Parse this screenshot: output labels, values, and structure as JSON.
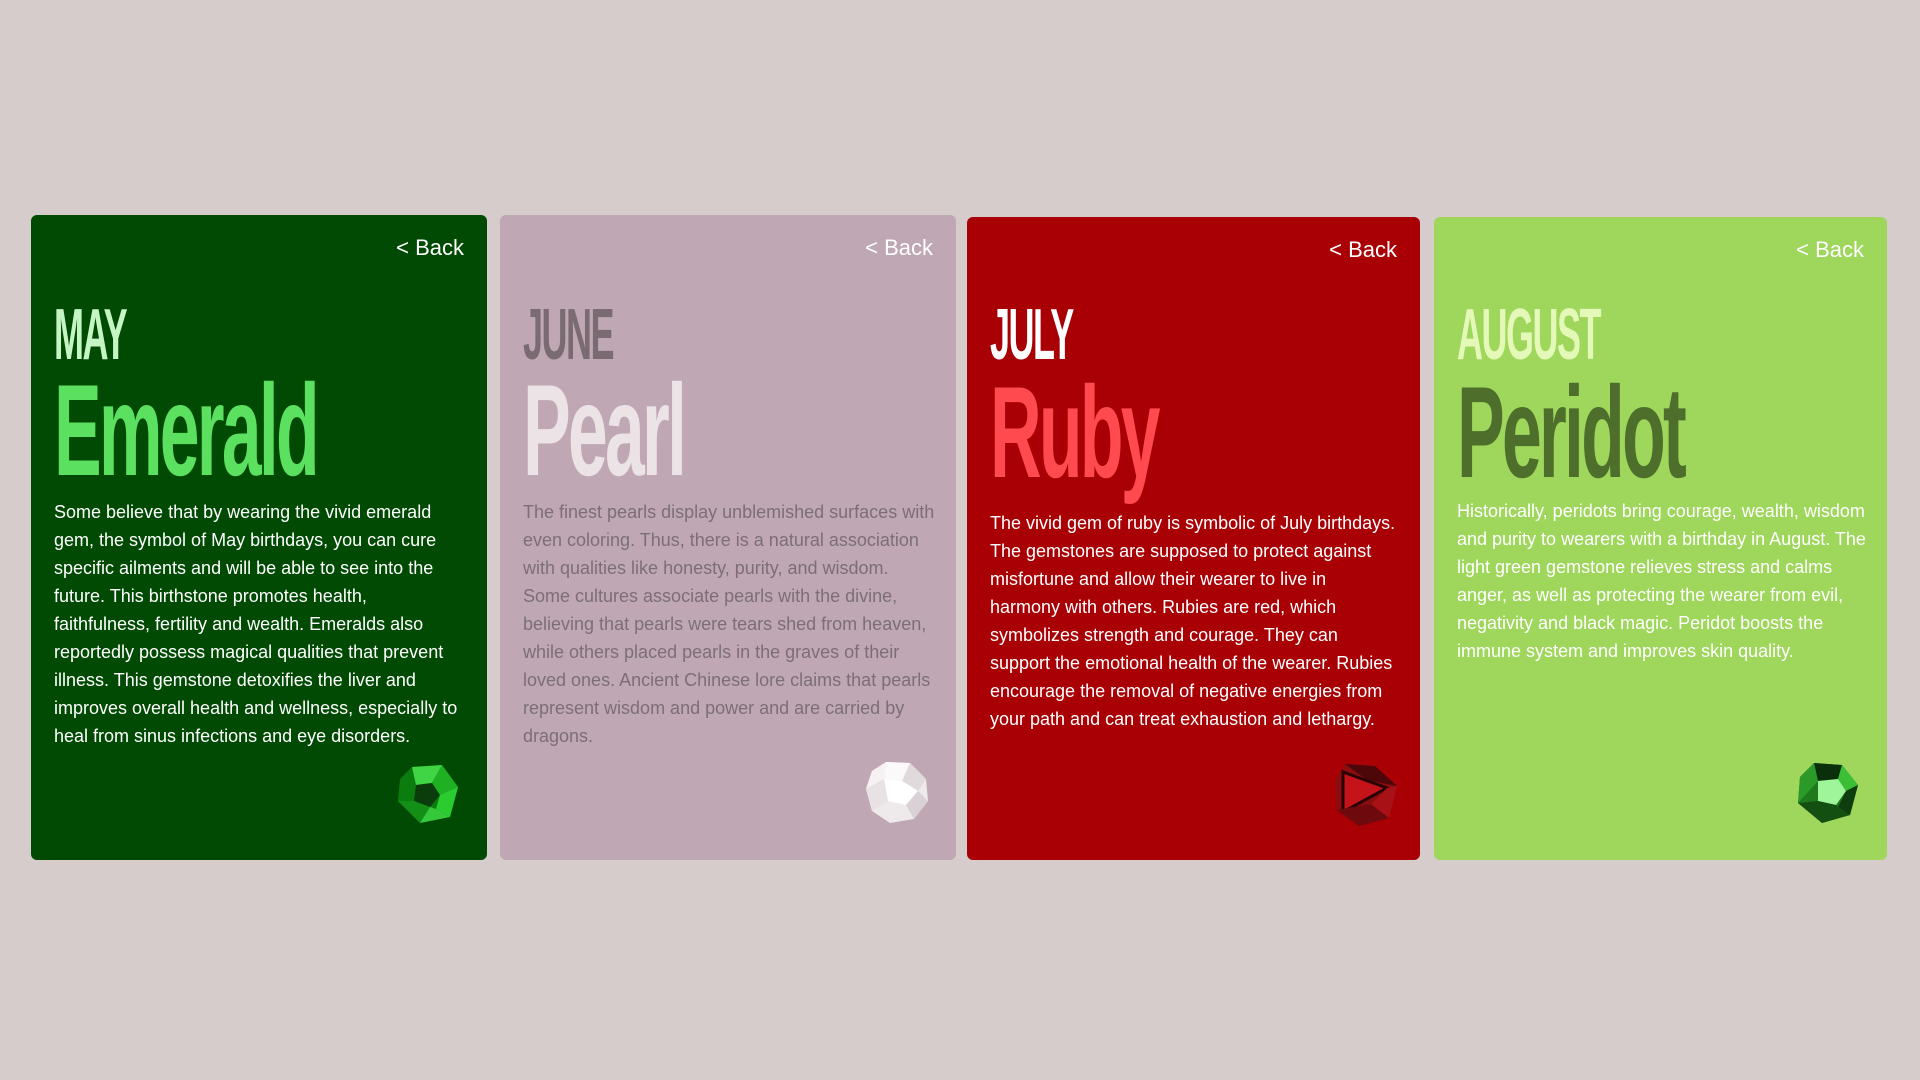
{
  "cards": [
    {
      "back_label": "< Back",
      "month": "MAY",
      "gem": "Emerald",
      "description": "Some believe that by wearing the vivid emerald gem, the symbol of May birthdays, you can cure specific ailments and will be able to see into the future. This birthstone promotes health, faithfulness, fertility and wealth. Emeralds also reportedly possess magical qualities that prevent illness. This gemstone detoxifies the liver and improves overall health and wellness, especially to heal from sinus infections and eye disorders.",
      "gem_icon": "emerald-gem-icon",
      "colors": {
        "background": "#014a03",
        "month": "#c6f5c4",
        "gem": "#5ce05f",
        "text": "#ffffff",
        "back": "#ffffff"
      }
    },
    {
      "back_label": "< Back",
      "month": "JUNE",
      "gem": "Pearl",
      "description": "The finest pearls display unblemished surfaces with even coloring. Thus, there is a natural association with qualities like honesty, purity, and wisdom. Some cultures associate pearls with the divine, believing that pearls were tears shed from heaven, while others placed pearls in the graves of their loved ones. Ancient Chinese lore claims that pearls represent wisdom and power and are carried by dragons.",
      "gem_icon": "pearl-gem-icon",
      "colors": {
        "background": "#bfa7b4",
        "month": "#7a6b72",
        "gem": "#ece3e6",
        "text": "#7d6e76",
        "back": "#ffffff"
      }
    },
    {
      "back_label": "< Back",
      "month": "JULY",
      "gem": "Ruby",
      "description": "The vivid gem of ruby is symbolic of July birthdays. The gemstones are supposed to protect against misfortune and allow their wearer to live in harmony with others. Rubies are red, which symbolizes strength and courage. They can support the emotional health of the wearer. Rubies encourage the removal of negative energies from your path and can treat exhaustion and lethargy.",
      "gem_icon": "ruby-gem-icon",
      "colors": {
        "background": "#a80005",
        "month": "#ffffff",
        "gem": "#ff4a4f",
        "text": "#ffffff",
        "back": "#ffffff"
      }
    },
    {
      "back_label": "< Back",
      "month": "AUGUST",
      "gem": "Peridot",
      "description": "Historically, peridots bring courage, wealth, wisdom and purity to wearers with a birthday in August. The light green gemstone relieves stress and calms anger, as well as protecting the wearer from evil, negativity and black magic. Peridot boosts the immune system and improves skin quality.",
      "gem_icon": "peridot-gem-icon",
      "colors": {
        "background": "#9fd65c",
        "month": "#e4f9b8",
        "gem": "#4d6f2b",
        "text": "#ffffff",
        "back": "#ffffff"
      }
    }
  ]
}
